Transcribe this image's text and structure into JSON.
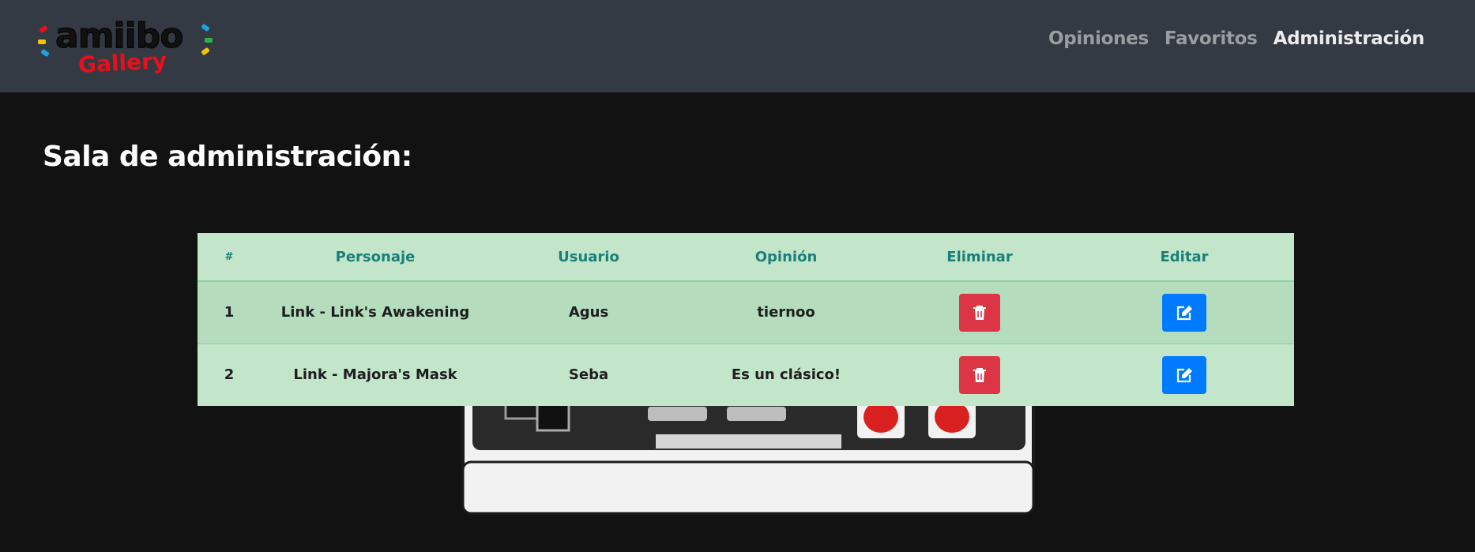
{
  "logo": {
    "word": "amiibo",
    "sub": "Gallery"
  },
  "nav": {
    "links": [
      {
        "label": "Opiniones",
        "active": false
      },
      {
        "label": "Favoritos",
        "active": false
      },
      {
        "label": "Administración",
        "active": true
      }
    ]
  },
  "page": {
    "title": "Sala de administración:"
  },
  "table": {
    "headers": [
      "#",
      "Personaje",
      "Usuario",
      "Opinión",
      "Eliminar",
      "Editar"
    ],
    "rows": [
      {
        "num": "1",
        "personaje": "Link - Link's Awakening",
        "usuario": "Agus",
        "opinion": "tiernoo"
      },
      {
        "num": "2",
        "personaje": "Link - Majora's Mask",
        "usuario": "Seba",
        "opinion": "Es un clásico!"
      }
    ]
  },
  "icons": {
    "delete": "trash-icon",
    "edit": "edit-icon"
  },
  "colors": {
    "navbar_bg": "#343a43",
    "page_bg": "#121212",
    "table_bg": "#c3e6cb",
    "header_text": "#1a7f7a",
    "delete_btn": "#dc3545",
    "edit_btn": "#007bff"
  }
}
